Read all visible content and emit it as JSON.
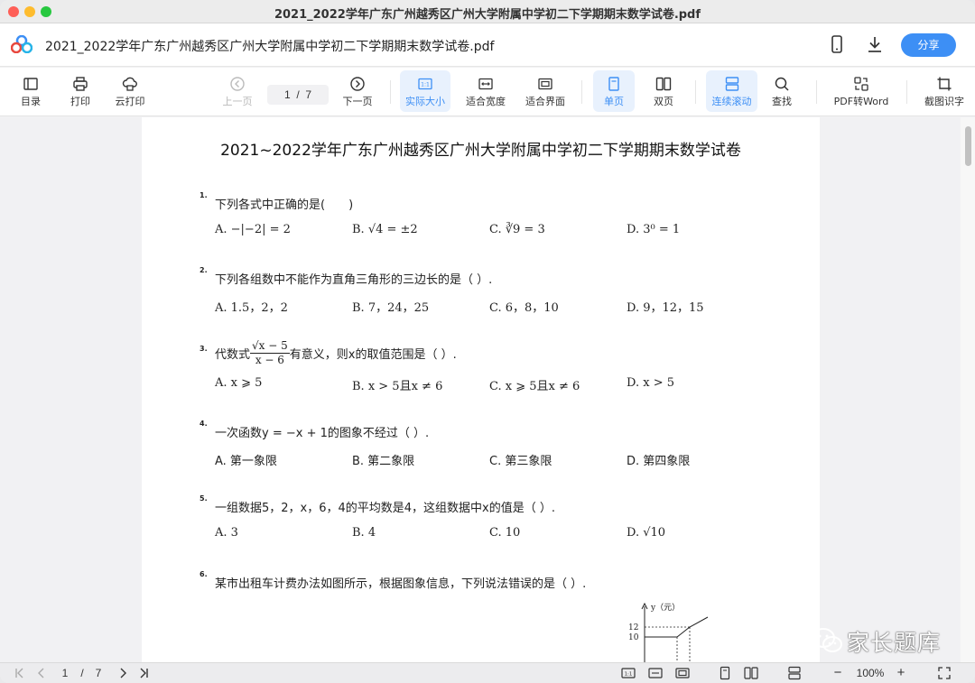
{
  "window": {
    "title": "2021_2022学年广东广州越秀区广州大学附属中学初二下学期期末数学试卷.pdf"
  },
  "header": {
    "doc_title": "2021_2022学年广东广州越秀区广州大学附属中学初二下学期期末数学试卷.pdf",
    "share_label": "分享",
    "accent": "#3d8ff5"
  },
  "toolbar": {
    "toc": "目录",
    "print": "打印",
    "cloud_print": "云打印",
    "prev_page": "上一页",
    "page_current": "1",
    "page_sep": "/",
    "page_total": "7",
    "next_page": "下一页",
    "actual_size": "实际大小",
    "fit_width": "适合宽度",
    "fit_window": "适合界面",
    "single_page": "单页",
    "double_page": "双页",
    "continuous_scroll": "连续滚动",
    "search": "查找",
    "pdf_to_word": "PDF转Word",
    "screenshot_ocr": "截图识字"
  },
  "document": {
    "title": "2021~2022学年广东广州越秀区广州大学附属中学初二下学期期末数学试卷",
    "questions": [
      {
        "num": "1.",
        "text": "下列各式中正确的是(　　)",
        "options": [
          "A. −|−2| = 2",
          "B. √4 = ±2",
          "C. ∛9 = 3",
          "D. 3⁰ = 1"
        ]
      },
      {
        "num": "2.",
        "text": "下列各组数中不能作为直角三角形的三边长的是（  ）.",
        "options": [
          "A. 1.5，2，2",
          "B. 7，24，25",
          "C. 6，8，10",
          "D. 9，12，15"
        ]
      },
      {
        "num": "3.",
        "text_before": "代数式",
        "frac_num": "√x − 5",
        "frac_den": "x − 6",
        "text_after": "有意义，则x的取值范围是（  ）.",
        "options": [
          "A. x ⩾ 5",
          "B. x > 5且x ≠ 6",
          "C. x ⩾ 5且x ≠ 6",
          "D. x > 5"
        ]
      },
      {
        "num": "4.",
        "text": "一次函数y = −x + 1的图象不经过（  ）.",
        "options": [
          "A. 第一象限",
          "B. 第二象限",
          "C. 第三象限",
          "D. 第四象限"
        ]
      },
      {
        "num": "5.",
        "text": "一组数据5，2，x，6，4的平均数是4，这组数据中x的值是（  ）.",
        "options": [
          "A. 3",
          "B. 4",
          "C. 10",
          "D. √10"
        ]
      },
      {
        "num": "6.",
        "text": "某市出租车计费办法如图所示，根据图象信息，下列说法错误的是（  ）."
      }
    ],
    "graph": {
      "ylabel": "y（元）",
      "tick_12": "12",
      "tick_10": "10"
    }
  },
  "watermark": {
    "text": "家长题库"
  },
  "bottombar": {
    "page_current": "1",
    "page_sep": "/",
    "page_total": "7",
    "zoom": "100%",
    "zoom_out": "−",
    "zoom_in": "+"
  }
}
